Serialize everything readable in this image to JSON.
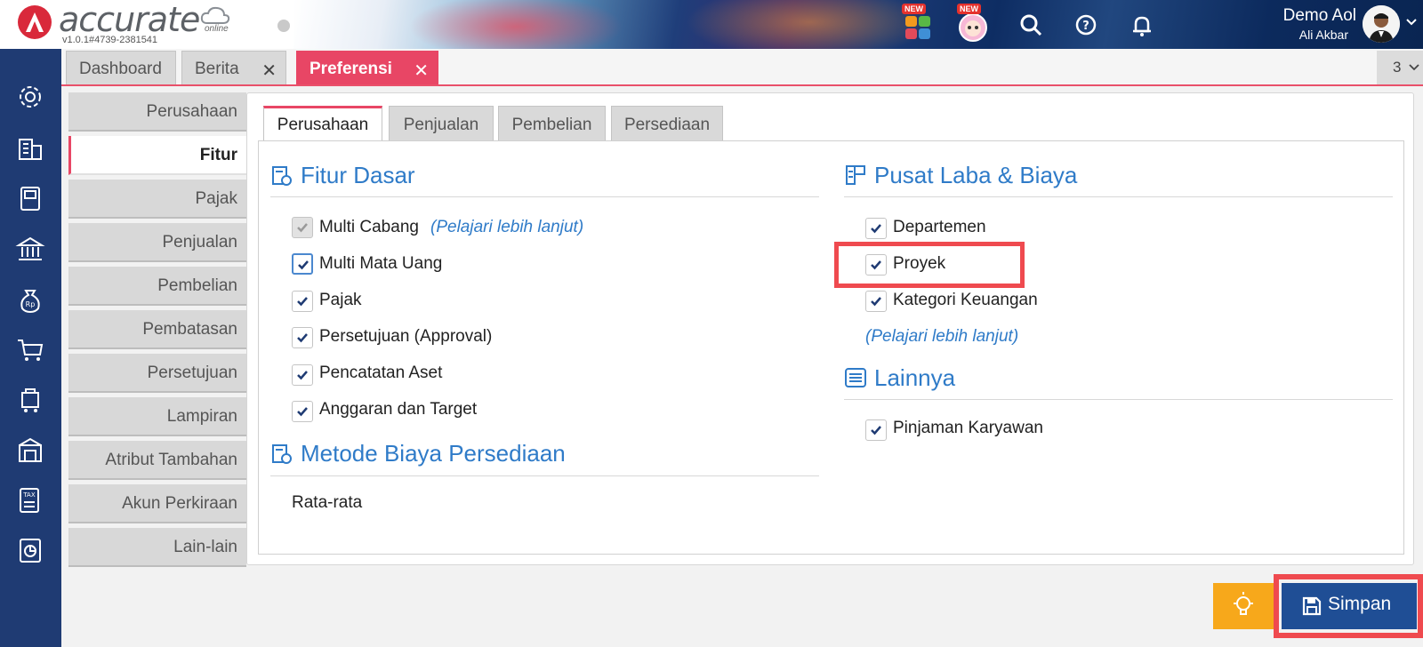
{
  "header": {
    "brand": "accurate",
    "brand_suffix": "online",
    "version": "v1.0.1#4739-2381541",
    "new_badge": "NEW",
    "user_name": "Demo Aol",
    "user_sub": "Ali Akbar",
    "colors": {
      "brand_red": "#d9293b",
      "nav_dark": "#1f3b73",
      "accent_pink": "#e84665",
      "link_blue": "#2f7bc8"
    }
  },
  "rail": {
    "icons": [
      "settings-icon",
      "building-icon",
      "book-icon",
      "bank-icon",
      "money-bag-icon",
      "cart-icon",
      "purchase-cart-icon",
      "warehouse-icon",
      "tax-icon",
      "report-icon"
    ]
  },
  "tabs": {
    "dashboard": "Dashboard",
    "berita": "Berita",
    "preferensi": "Preferensi",
    "count": "3"
  },
  "side_menu": {
    "items": [
      "Perusahaan",
      "Fitur",
      "Pajak",
      "Penjualan",
      "Pembelian",
      "Pembatasan",
      "Persetujuan",
      "Lampiran",
      "Atribut Tambahan",
      "Akun Perkiraan",
      "Lain-lain"
    ],
    "active": "Fitur"
  },
  "inner_tabs": {
    "items": [
      "Perusahaan",
      "Penjualan",
      "Pembelian",
      "Persediaan"
    ],
    "active": "Perusahaan"
  },
  "fitur_dasar": {
    "title": "Fitur Dasar",
    "items": [
      {
        "label": "Multi Cabang",
        "checked": true,
        "disabled": true
      },
      {
        "label": "Multi Mata Uang",
        "checked": true
      },
      {
        "label": "Pajak",
        "checked": true
      },
      {
        "label": "Persetujuan (Approval)",
        "checked": true
      },
      {
        "label": "Pencatatan Aset",
        "checked": true
      },
      {
        "label": "Anggaran dan Target",
        "checked": true
      }
    ],
    "learn_more": "(Pelajari lebih lanjut)"
  },
  "metode_biaya": {
    "title": "Metode Biaya Persediaan",
    "value": "Rata-rata"
  },
  "pusat_laba": {
    "title": "Pusat Laba & Biaya",
    "items": [
      {
        "label": "Departemen",
        "checked": true
      },
      {
        "label": "Proyek",
        "checked": true
      },
      {
        "label": "Kategori Keuangan",
        "checked": true
      }
    ],
    "learn_more": "(Pelajari lebih lanjut)"
  },
  "lainnya": {
    "title": "Lainnya",
    "items": [
      {
        "label": "Pinjaman Karyawan",
        "checked": true
      }
    ]
  },
  "actions": {
    "save": "Simpan"
  }
}
